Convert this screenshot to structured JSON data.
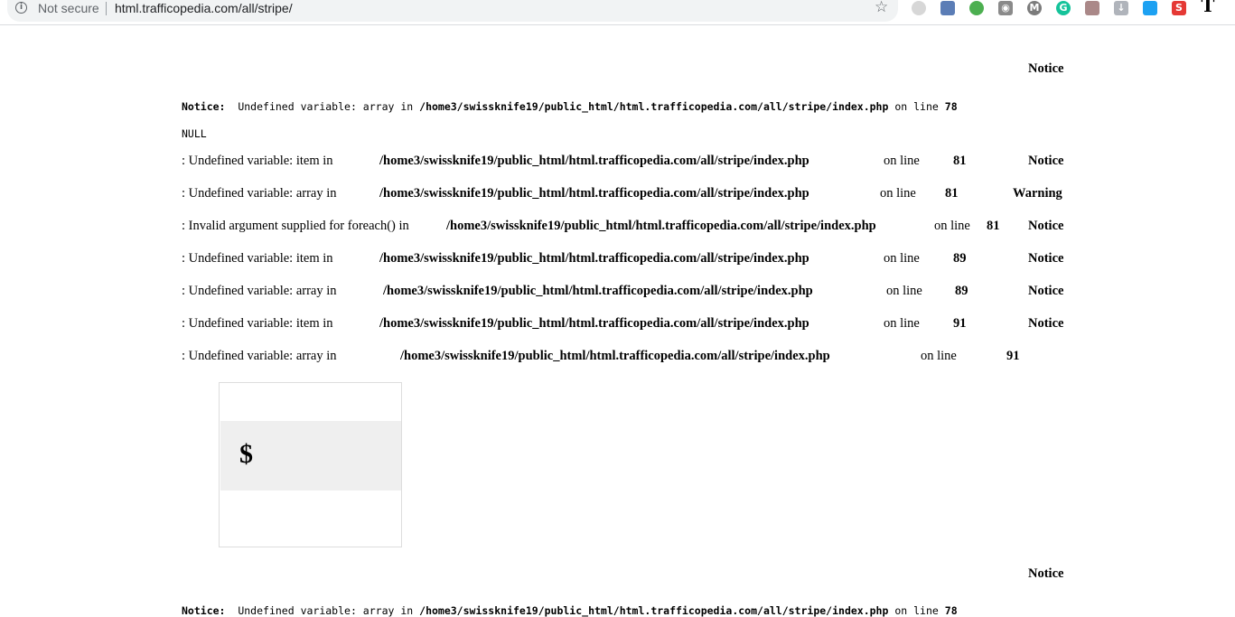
{
  "browser": {
    "security_label": "Not secure",
    "url": "html.trafficopedia.com/all/stripe/",
    "bookmark_icon": "star-icon",
    "extensions": [
      "extension-1-icon",
      "extension-2-icon",
      "extension-3-icon",
      "camera-icon",
      "m-icon",
      "grammarly-icon",
      "pdf-icon",
      "download-icon",
      "twitter-icon",
      "s-icon",
      "t-icon"
    ]
  },
  "page": {
    "heading_notice_top": "Notice",
    "mono_notice_label": "Notice:",
    "mono_notice_text": "Undefined variable: array in",
    "mono_notice_path": "/home3/swissknife19/public_html/html.trafficopedia.com/all/stripe/index.php",
    "mono_notice_online": "on line",
    "mono_notice_line": "78",
    "null_text": "NULL",
    "rows": [
      {
        "msg": ": Undefined variable: item in",
        "path": "/home3/swissknife19/public_html/html.trafficopedia.com/all/stripe/index.php",
        "online": "on line",
        "line": "81",
        "next": "Notice"
      },
      {
        "msg": ": Undefined variable: array in",
        "path": "/home3/swissknife19/public_html/html.trafficopedia.com/all/stripe/index.php",
        "online": "on line",
        "line": "81",
        "next": "Warning"
      },
      {
        "msg": ": Invalid argument supplied for foreach() in",
        "path": "/home3/swissknife19/public_html/html.trafficopedia.com/all/stripe/index.php",
        "online": "on line",
        "line": "81",
        "next": "Notice"
      },
      {
        "msg": ": Undefined variable: item in",
        "path": "/home3/swissknife19/public_html/html.trafficopedia.com/all/stripe/index.php",
        "online": "on line",
        "line": "89",
        "next": "Notice"
      },
      {
        "msg": ": Undefined variable: array in",
        "path": "/home3/swissknife19/public_html/html.trafficopedia.com/all/stripe/index.php",
        "online": "on line",
        "line": "89",
        "next": "Notice"
      },
      {
        "msg": ": Undefined variable: item in",
        "path": "/home3/swissknife19/public_html/html.trafficopedia.com/all/stripe/index.php",
        "online": "on line",
        "line": "91",
        "next": "Notice"
      },
      {
        "msg": ": Undefined variable: array in",
        "path": "/home3/swissknife19/public_html/html.trafficopedia.com/all/stripe/index.php",
        "online": "on line",
        "line": "91",
        "next": ""
      }
    ],
    "price_symbol": "$",
    "heading_notice_bottom": "Notice",
    "bottom_mono_label": "Notice:",
    "bottom_mono_text": "Undefined variable: array in",
    "bottom_mono_path": "/home3/swissknife19/public_html/html.trafficopedia.com/all/stripe/index.php",
    "bottom_mono_online": "on line",
    "bottom_mono_line": "78"
  }
}
